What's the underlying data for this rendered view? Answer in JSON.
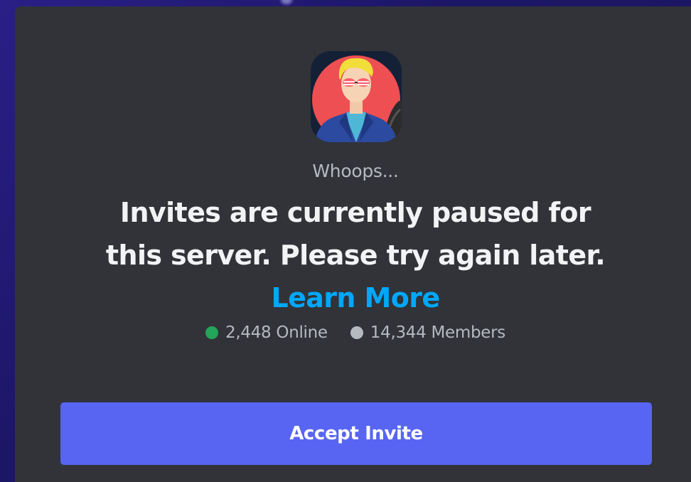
{
  "invite": {
    "server_icon": "server-avatar-cartoon-man-sunglasses",
    "subtitle": "Whoops...",
    "message": "Invites are currently paused for this server. Please try again later.",
    "learn_more_label": "Learn More",
    "online": {
      "count_text": "2,448 Online",
      "dot_color": "#23a55a"
    },
    "members": {
      "count_text": "14,344 Members",
      "dot_color": "#b5bac1"
    },
    "accept_label": "Accept Invite"
  },
  "colors": {
    "modal_background": "#313338",
    "button": "#5865f2",
    "link": "#00a8fc",
    "heading_text": "#f2f3f5",
    "muted_text": "#b5bac1"
  }
}
